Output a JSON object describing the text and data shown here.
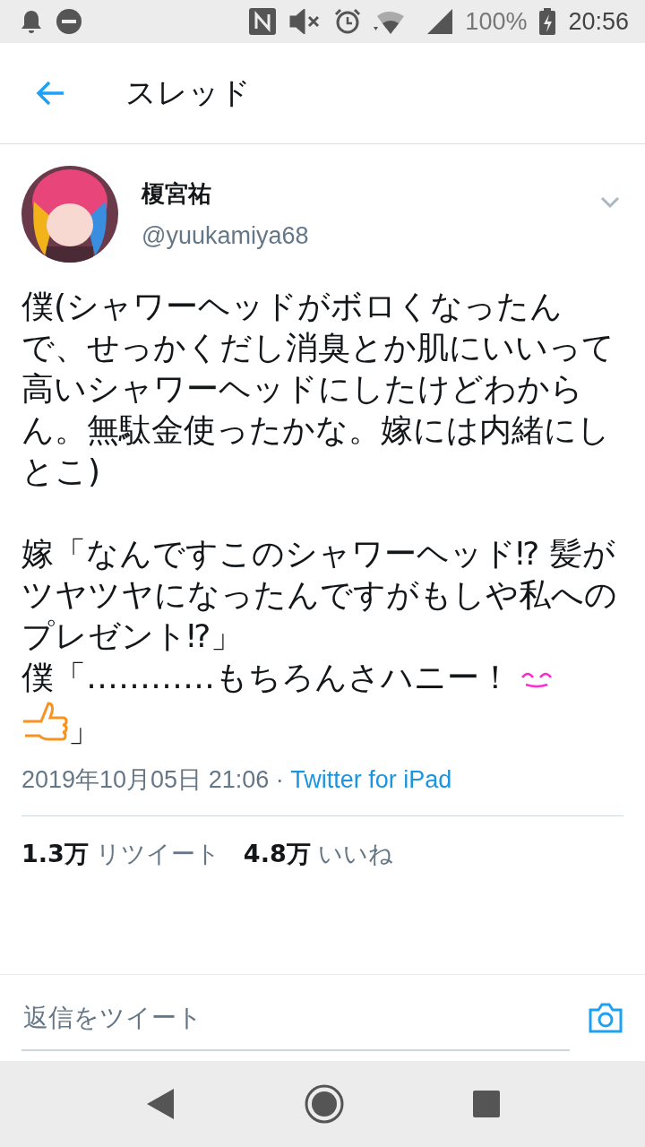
{
  "status_bar": {
    "battery": "100%",
    "time": "20:56"
  },
  "header": {
    "title": "スレッド"
  },
  "tweet": {
    "name": "榎宮祐",
    "handle": "@yuukamiya68",
    "paragraphs": [
      "僕(シャワーヘッドがボロくなったんで、せっかくだし消臭とか肌にいいって高いシャワーヘッドにしたけどわからん。無駄金使ったかな。嫁には内緒にしとこ)",
      "嫁「なんですこのシャワーヘッド⁉ 髪がツヤツヤになったんですがもしや私へのプレゼント⁉」"
    ],
    "last_line": {
      "text": "僕「…………もちろんさハニー！",
      "closing": "」"
    },
    "timestamp": "2019年10月05日 21:06 · ",
    "source": "Twitter for iPad",
    "stats": [
      {
        "count": "1.3万",
        "label": "リツイート"
      },
      {
        "count": "4.8万",
        "label": "いいね"
      }
    ]
  },
  "reply": {
    "placeholder": "返信をツイート"
  }
}
